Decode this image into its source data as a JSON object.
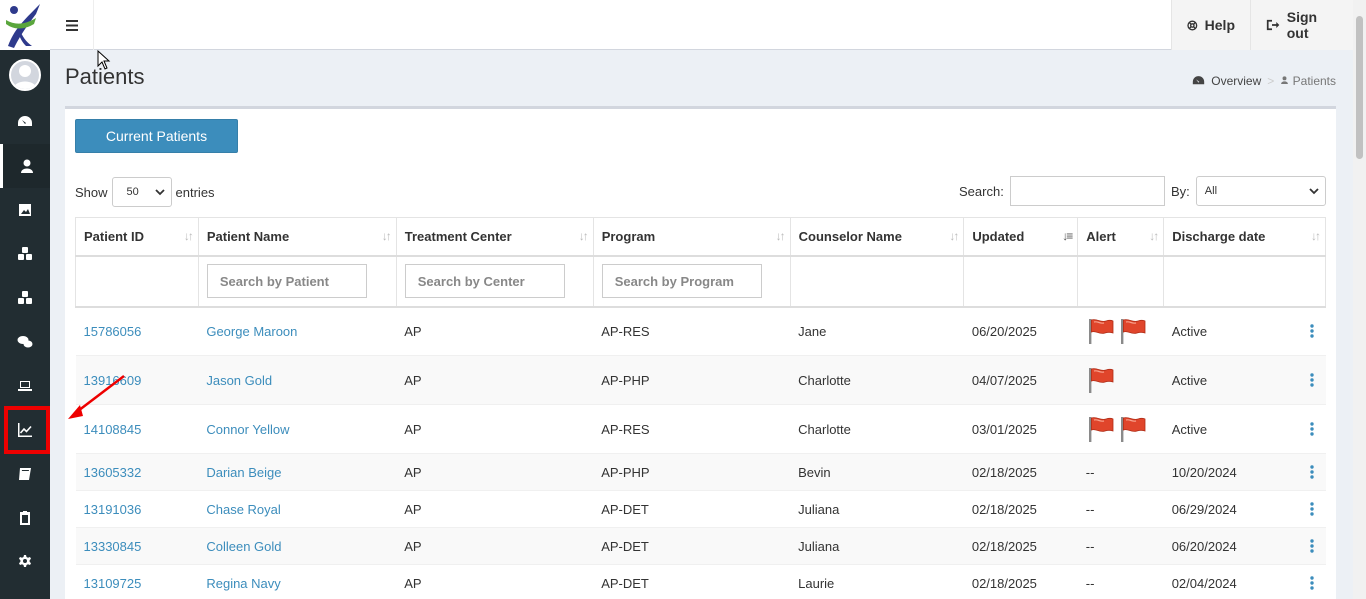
{
  "topbar": {
    "help_label": "Help",
    "signout_label": "Sign out"
  },
  "header": {
    "title": "Patients"
  },
  "breadcrumb": {
    "home": "Overview",
    "separator": ">",
    "current": "Patients"
  },
  "controls": {
    "current_patients_label": "Current Patients",
    "show_label": "Show",
    "show_value": "50",
    "entries_label": "entries",
    "search_label": "Search:",
    "by_label": "By:",
    "by_value": "All"
  },
  "table": {
    "columns": [
      "Patient ID",
      "Patient Name",
      "Treatment Center",
      "Program",
      "Counselor Name",
      "Updated",
      "Alert",
      "Discharge date"
    ],
    "filters": {
      "patient": "Search by Patient",
      "center": "Search by Center",
      "program": "Search by Program"
    },
    "rows": [
      {
        "id": "15786056",
        "name": "George Maroon",
        "center": "AP",
        "program": "AP-RES",
        "counselor": "Jane",
        "updated": "06/20/2025",
        "alert": "",
        "discharge": "Active"
      },
      {
        "id": "13916609",
        "name": "Jason Gold",
        "center": "AP",
        "program": "AP-PHP",
        "counselor": "Charlotte",
        "updated": "04/07/2025",
        "alert": "",
        "discharge": "Active"
      },
      {
        "id": "14108845",
        "name": "Connor Yellow",
        "center": "AP",
        "program": "AP-RES",
        "counselor": "Charlotte",
        "updated": "03/01/2025",
        "alert": "",
        "discharge": "Active"
      },
      {
        "id": "13605332",
        "name": "Darian Beige",
        "center": "AP",
        "program": "AP-PHP",
        "counselor": "Bevin",
        "updated": "02/18/2025",
        "alert": "--",
        "discharge": "10/20/2024"
      },
      {
        "id": "13191036",
        "name": "Chase Royal",
        "center": "AP",
        "program": "AP-DET",
        "counselor": "Juliana",
        "updated": "02/18/2025",
        "alert": "--",
        "discharge": "06/29/2024"
      },
      {
        "id": "13330845",
        "name": "Colleen Gold",
        "center": "AP",
        "program": "AP-DET",
        "counselor": "Juliana",
        "updated": "02/18/2025",
        "alert": "--",
        "discharge": "06/20/2024"
      },
      {
        "id": "13109725",
        "name": "Regina Navy",
        "center": "AP",
        "program": "AP-DET",
        "counselor": "Laurie",
        "updated": "02/18/2025",
        "alert": "--",
        "discharge": "02/04/2024"
      }
    ]
  },
  "colors": {
    "accent": "#3c8dbc",
    "sidebar": "#222d32",
    "flag": "#e0452b",
    "highlight": "#e00000"
  },
  "icons": {
    "sidebar": [
      "dashboard-icon",
      "user-icon",
      "image-icon",
      "cubes-icon",
      "cubes-icon",
      "chat-icon",
      "laptop-icon",
      "chart-line-icon",
      "book-icon",
      "clipboard-icon",
      "gear-icon"
    ]
  }
}
